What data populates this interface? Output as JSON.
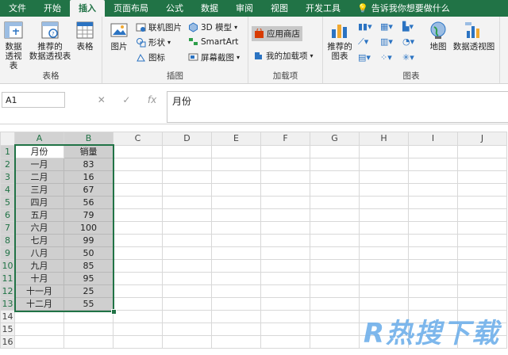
{
  "tabs": [
    "文件",
    "开始",
    "插入",
    "页面布局",
    "公式",
    "数据",
    "审阅",
    "视图",
    "开发工具"
  ],
  "active_tab": "插入",
  "tell_me": "告诉我你想要做什么",
  "ribbon": {
    "tables": {
      "label": "表格",
      "pivot": "数据\n透视表",
      "rec_pivot": "推荐的\n数据透视表",
      "table": "表格"
    },
    "illustrations": {
      "label": "插图",
      "picture": "图片",
      "online_picture": "联机图片",
      "shapes": "形状",
      "icons": "图标",
      "model3d": "3D 模型",
      "smartart": "SmartArt",
      "screenshot": "屏幕截图"
    },
    "addins": {
      "label": "加载项",
      "store": "应用商店",
      "my_addins": "我的加载项"
    },
    "charts": {
      "label": "图表",
      "recommended": "推荐的\n图表",
      "map": "地图",
      "pivot_chart": "数据透视图"
    }
  },
  "formula_bar": {
    "name_box": "A1",
    "cancel": "✕",
    "enter": "✓",
    "fx": "fx",
    "content": "月份"
  },
  "columns": [
    "A",
    "B",
    "C",
    "D",
    "E",
    "F",
    "G",
    "H",
    "I",
    "J"
  ],
  "rows": [
    [
      "月份",
      "销量"
    ],
    [
      "一月",
      "83"
    ],
    [
      "二月",
      "16"
    ],
    [
      "三月",
      "67"
    ],
    [
      "四月",
      "56"
    ],
    [
      "五月",
      "79"
    ],
    [
      "六月",
      "100"
    ],
    [
      "七月",
      "99"
    ],
    [
      "八月",
      "50"
    ],
    [
      "九月",
      "85"
    ],
    [
      "十月",
      "95"
    ],
    [
      "十一月",
      "25"
    ],
    [
      "十二月",
      "55"
    ],
    [
      "",
      ""
    ],
    [
      "",
      ""
    ],
    [
      "",
      ""
    ]
  ],
  "watermark": "R热搜下载",
  "colors": {
    "accent": "#217346",
    "selection": "#cfcfcf"
  }
}
